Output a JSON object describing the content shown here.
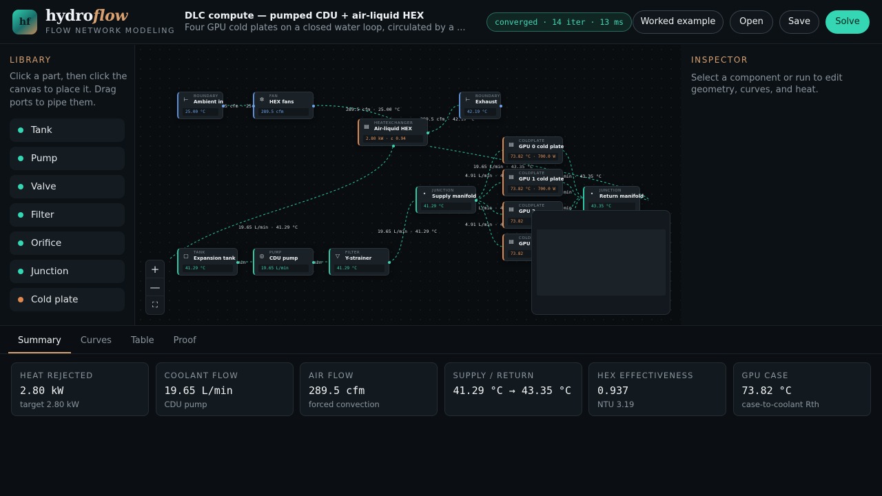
{
  "app": {
    "logo_text": "hf",
    "name_main": "hydro",
    "name_accent": "flow",
    "subtitle": "FLOW NETWORK MODELING"
  },
  "document": {
    "title": "DLC compute — pumped CDU + air-liquid HEX",
    "description": "Four GPU cold plates on a closed water loop, circulated by a ..."
  },
  "status": "converged · 14 iter · 13 ms",
  "toolbar": {
    "worked_example": "Worked example",
    "open": "Open",
    "save": "Save",
    "solve": "Solve"
  },
  "library": {
    "title": "LIBRARY",
    "hint": "Click a part, then click the canvas to place it. Drag ports to pipe them.",
    "items": [
      {
        "label": "Tank",
        "color": "#34d6b3"
      },
      {
        "label": "Pump",
        "color": "#34d6b3"
      },
      {
        "label": "Valve",
        "color": "#34d6b3"
      },
      {
        "label": "Filter",
        "color": "#34d6b3"
      },
      {
        "label": "Orifice",
        "color": "#34d6b3"
      },
      {
        "label": "Junction",
        "color": "#34d6b3"
      },
      {
        "label": "Cold plate",
        "color": "#e0884e"
      }
    ]
  },
  "canvas": {
    "nodes": {
      "ambient": {
        "type": "BOUNDARY",
        "name": "Ambient in",
        "value": "25.00 °C"
      },
      "fans": {
        "type": "FAN",
        "name": "HEX fans",
        "value": "289.5 cfm"
      },
      "exhaust": {
        "type": "BOUNDARY",
        "name": "Exhaust",
        "value": "42.19 °C"
      },
      "hex": {
        "type": "HEATEXCHANGER",
        "name": "Air-liquid HEX",
        "value": "2.80 kW · ε 0.94"
      },
      "gpu0": {
        "type": "COLDPLATE",
        "name": "GPU 0 cold plate",
        "value": "73.82 °C · 700.0 W"
      },
      "gpu1": {
        "type": "COLDPLATE",
        "name": "GPU 1 cold plate",
        "value": "73.82 °C · 700.0 W"
      },
      "gpu2": {
        "type": "COLDPLATE",
        "name": "GPU 2",
        "value": "73.82"
      },
      "gpu3": {
        "type": "COLDPLATE",
        "name": "GPU 3",
        "value": "73.82"
      },
      "supply": {
        "type": "JUNCTION",
        "name": "Supply manifold",
        "value": "41.29 °C"
      },
      "return": {
        "type": "JUNCTION",
        "name": "Return manifold",
        "value": "43.35 °C"
      },
      "tank": {
        "type": "TANK",
        "name": "Expansion tank",
        "value": "41.29 °C"
      },
      "pump": {
        "type": "PUMP",
        "name": "CDU pump",
        "value": "19.65 L/min"
      },
      "strainer": {
        "type": "FILTER",
        "name": "Y-strainer",
        "value": "41.29 °C"
      }
    },
    "wire_labels": [
      "25 cfm · 25.00",
      "289.5 cfm · 25.00 °C",
      "289.5 cfm · 42.19 °C",
      "19.65 L/min · 43.35 °C",
      "4.91 L/min · 41.29",
      "4.91 L/min · 41.2",
      "4.91 L/min · 41.2",
      "19.65 L/min · 41.29 °C",
      "19.65 L/min · 41.29 °C",
      "min · 43.35 °C",
      "min",
      "min",
      "min",
      "min",
      "min"
    ],
    "zoom": {
      "in": "+",
      "out": "—",
      "fit": "⛶"
    }
  },
  "inspector": {
    "title": "INSPECTOR",
    "hint": "Select a component or run to edit geometry, curves, and heat."
  },
  "bottom": {
    "tabs": [
      {
        "label": "Summary",
        "active": true
      },
      {
        "label": "Curves",
        "active": false
      },
      {
        "label": "Table",
        "active": false
      },
      {
        "label": "Proof",
        "active": false
      }
    ],
    "cards": [
      {
        "label": "HEAT REJECTED",
        "value": "2.80 kW",
        "sub": "target 2.80 kW"
      },
      {
        "label": "COOLANT FLOW",
        "value": "19.65 L/min",
        "sub": "CDU pump"
      },
      {
        "label": "AIR FLOW",
        "value": "289.5 cfm",
        "sub": "forced convection"
      },
      {
        "label": "SUPPLY / RETURN",
        "value": "41.29 °C → 43.35 °C",
        "sub": ""
      },
      {
        "label": "HEX EFFECTIVENESS",
        "value": "0.937",
        "sub": "NTU 3.19"
      },
      {
        "label": "GPU CASE",
        "value": "73.82 °C",
        "sub": "case-to-coolant Rth"
      }
    ]
  }
}
